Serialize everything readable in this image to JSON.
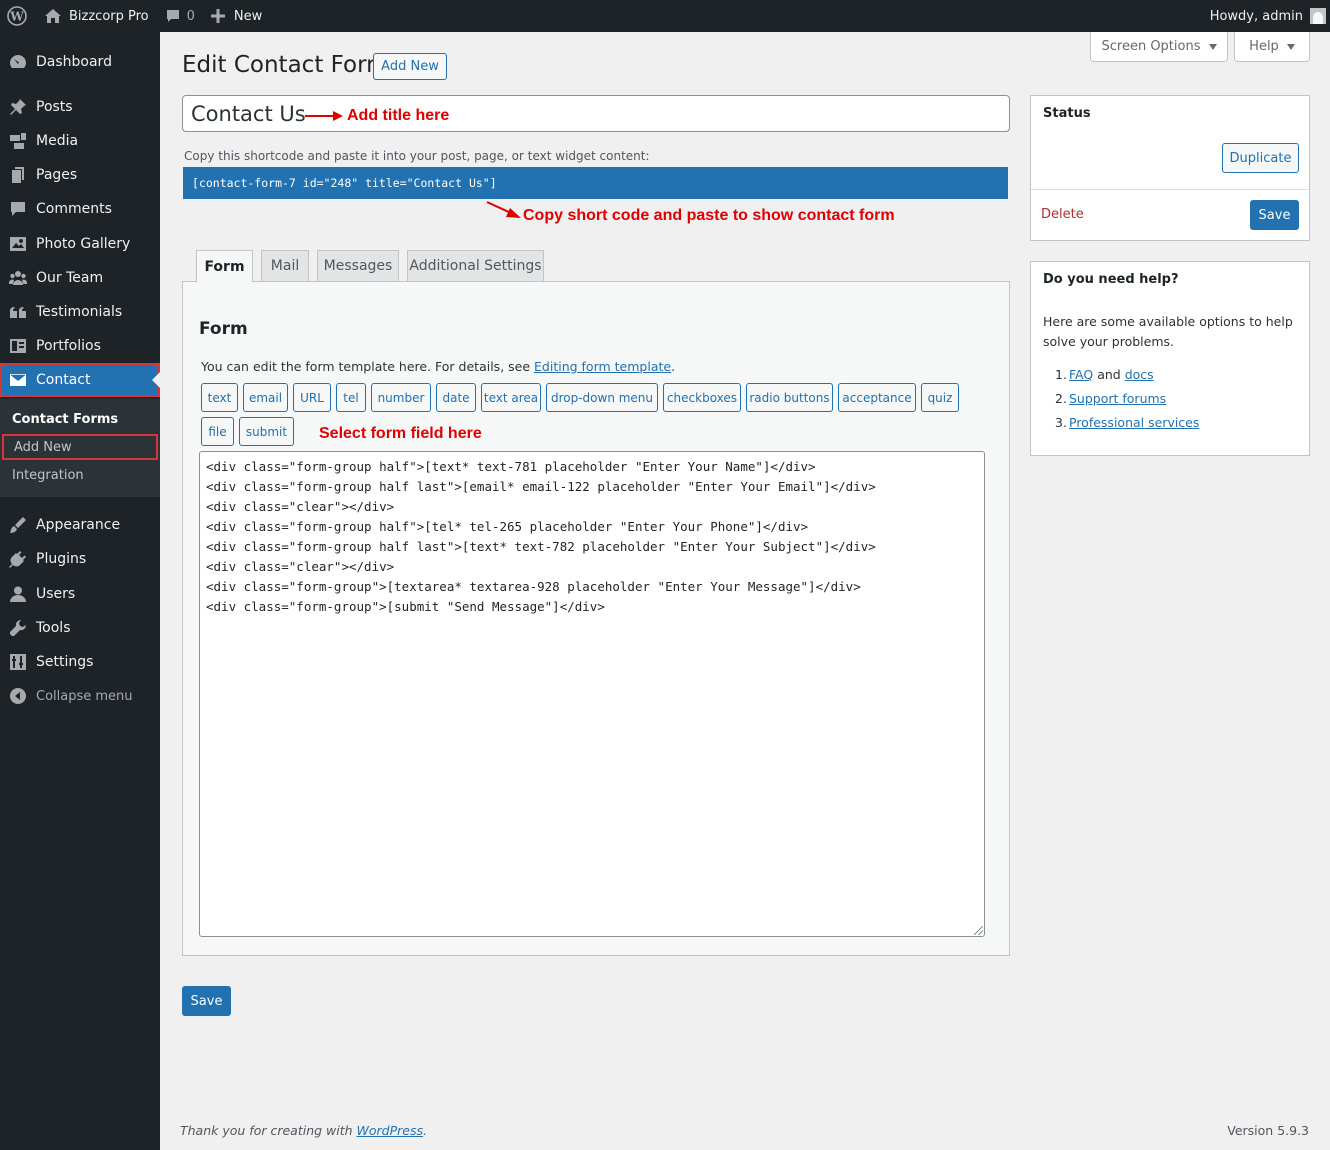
{
  "admin_bar": {
    "site_name": "Bizzcorp Pro",
    "comments_count": "0",
    "new_label": "New",
    "greeting": "Howdy, admin"
  },
  "sidebar": {
    "items": [
      {
        "label": "Dashboard",
        "icon": "dashboard-icon"
      },
      {
        "label": "Posts",
        "icon": "pin-icon"
      },
      {
        "label": "Media",
        "icon": "media-icon"
      },
      {
        "label": "Pages",
        "icon": "pages-icon"
      },
      {
        "label": "Comments",
        "icon": "comments-icon"
      },
      {
        "label": "Photo Gallery",
        "icon": "gallery-icon"
      },
      {
        "label": "Our Team",
        "icon": "team-icon"
      },
      {
        "label": "Testimonials",
        "icon": "quote-icon"
      },
      {
        "label": "Portfolios",
        "icon": "portfolio-icon"
      },
      {
        "label": "Contact",
        "icon": "envelope-icon"
      },
      {
        "label": "Appearance",
        "icon": "brush-icon"
      },
      {
        "label": "Plugins",
        "icon": "plugin-icon"
      },
      {
        "label": "Users",
        "icon": "user-icon"
      },
      {
        "label": "Tools",
        "icon": "wrench-icon"
      },
      {
        "label": "Settings",
        "icon": "settings-icon"
      },
      {
        "label": "Collapse menu",
        "icon": "collapse-icon"
      }
    ],
    "submenu": [
      "Contact Forms",
      "Add New",
      "Integration"
    ]
  },
  "header": {
    "title": "Edit Contact Form",
    "add_new": "Add New",
    "screen_options": "Screen Options",
    "help": "Help"
  },
  "form_title": {
    "value": "Contact Us",
    "annotation": "Add title here"
  },
  "shortcode": {
    "label": "Copy this shortcode and paste it into your post, page, or text widget content:",
    "value": "[contact-form-7 id=\"248\" title=\"Contact Us\"]",
    "annotation": "Copy short code and paste to show contact form"
  },
  "tabs": [
    "Form",
    "Mail",
    "Messages",
    "Additional Settings"
  ],
  "form_panel": {
    "title": "Form",
    "desc_prefix": "You can edit the form template here. For details, see ",
    "desc_link": "Editing form template",
    "desc_suffix": ".",
    "tag_buttons": [
      "text",
      "email",
      "URL",
      "tel",
      "number",
      "date",
      "text area",
      "drop-down menu",
      "checkboxes",
      "radio buttons",
      "acceptance",
      "quiz",
      "file",
      "submit"
    ],
    "annotation": "Select form field here",
    "code_lines": [
      "<div class=\"form-group half\">[text* text-781 placeholder \"Enter Your Name\"]</div>",
      "<div class=\"form-group half last\">[email* email-122 placeholder \"Enter Your Email\"]</div>",
      "<div class=\"clear\"></div>",
      "<div class=\"form-group half\">[tel* tel-265 placeholder \"Enter Your Phone\"]</div>",
      "<div class=\"form-group half last\">[text* text-782 placeholder \"Enter Your Subject\"]</div>",
      "<div class=\"clear\"></div>",
      "<div class=\"form-group\">[textarea* textarea-928 placeholder \"Enter Your Message\"]</div>",
      "<div class=\"form-group\">[submit \"Send Message\"]</div>"
    ],
    "save": "Save"
  },
  "status_box": {
    "title": "Status",
    "duplicate": "Duplicate",
    "delete": "Delete",
    "save": "Save"
  },
  "help_box": {
    "title": "Do you need help?",
    "text": "Here are some available options to help solve your problems.",
    "items": [
      {
        "num": "1.",
        "link1": "FAQ",
        "mid": " and ",
        "link2": "docs"
      },
      {
        "num": "2.",
        "link1": "Support forums"
      },
      {
        "num": "3.",
        "link1": "Professional services"
      }
    ]
  },
  "footer": {
    "prefix": "Thank you for creating with ",
    "link": "WordPress",
    "suffix": ".",
    "version": "Version 5.9.3"
  },
  "colors": {
    "accent": "#2271b1",
    "admin_dark": "#1d2327",
    "annotation_red": "#e00000",
    "delete_red": "#b32d2e"
  }
}
